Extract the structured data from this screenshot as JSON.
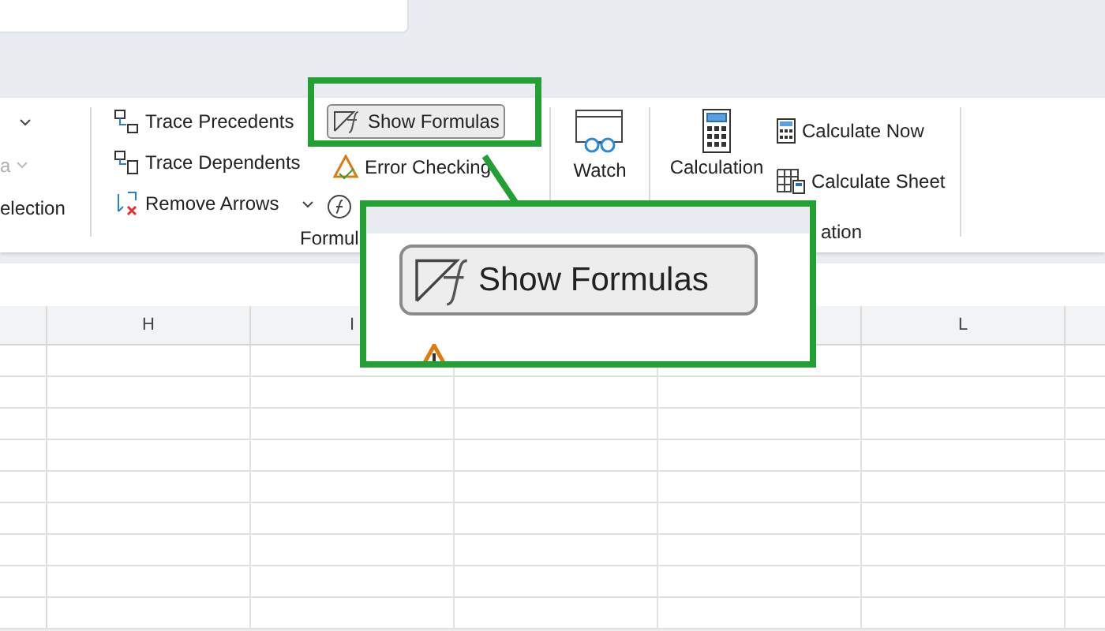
{
  "ribbon": {
    "left_group": {
      "items": [
        {
          "kind": "caret"
        },
        {
          "kind": "dropdown",
          "label": "a",
          "disabled": true
        },
        {
          "kind": "button",
          "label": "election",
          "disabled": false
        }
      ]
    },
    "formula_auditing": {
      "label": "Formul",
      "column_1": [
        {
          "label": "Trace Precedents"
        },
        {
          "label": "Trace Dependents"
        },
        {
          "label": "Remove Arrows"
        }
      ],
      "column_2": [
        {
          "label": "Show Formulas",
          "on": true
        },
        {
          "label": "Error Checking",
          "on": false
        },
        {
          "on": false
        }
      ]
    },
    "watch": {
      "label": "Watch"
    },
    "calculation": {
      "label": "ation",
      "options_label": "Calculation",
      "buttons": [
        {
          "label": "Calculate Now"
        },
        {
          "label": "Calculate Sheet"
        }
      ]
    }
  },
  "sheet": {
    "columns": [
      {
        "label": "H"
      },
      {
        "label": "I"
      },
      {},
      {},
      {
        "label": "L"
      },
      {}
    ]
  },
  "callout": {
    "button": {
      "label": "Show Formulas",
      "on": true
    }
  }
}
